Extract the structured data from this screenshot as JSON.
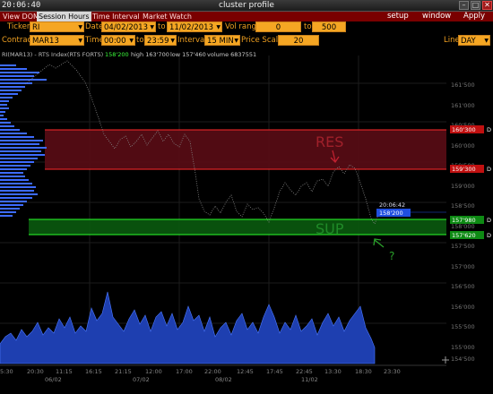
{
  "window": {
    "clock": "20:06:40",
    "title": "cluster profile",
    "minimize": "–",
    "maximize": "□",
    "close": "✕"
  },
  "menu": {
    "tabs": [
      "View DOM",
      "Session Hours",
      "Time Interval",
      "Market Watch"
    ],
    "active_tab": "Session Hours",
    "right": [
      "setup",
      "window",
      "Apply"
    ]
  },
  "params": {
    "ticker_label": "Ticker",
    "ticker": "RI",
    "date_label": "Date",
    "date_from": "04/02/2013",
    "to_label": "to",
    "date_to": "11/02/2013",
    "vol_range_label": "Vol range",
    "vol_from": "0",
    "vol_to_label": "to",
    "vol_to": "500",
    "contract_label": "Contract",
    "contract": "MAR13",
    "time_label": "Time",
    "time_from": "00:00",
    "time_to_label": "to",
    "time_to": "23:59",
    "interval_label": "Interval",
    "interval": "15 MIN",
    "price_scale_label": "Price Scale",
    "price_scale": "20",
    "line_label": "Line",
    "line": "DAY"
  },
  "legend": {
    "symbol": "RI(MAR13) - RTS Index(RTS FORTS)",
    "last": "158'200",
    "high": "high 163'700",
    "low": "low 157'460",
    "volume": "volume 6837551"
  },
  "price_axis": [
    "161'500",
    "161'000",
    "160'500",
    "160'000",
    "159'500",
    "159'000",
    "158'500",
    "158'000",
    "157'500",
    "157'000",
    "156'500",
    "156'000",
    "155'500",
    "155'000",
    "154'500"
  ],
  "levels": {
    "res_top": "160'300",
    "res_bottom": "159'300",
    "sup_top": "157'980",
    "sup_bottom": "157'620",
    "cursor_time": "20:06:42",
    "cursor_price": "158'200",
    "res_text": "RES",
    "sup_text": "SUP",
    "question": "?",
    "marker": "D"
  },
  "colors": {
    "res_zone": "#6a0e18",
    "sup_zone": "#0e6a12",
    "res_line": "#ff2a2a",
    "sup_line": "#2aff2a",
    "volume": "#2a56d8",
    "profile": "#3d6bff"
  },
  "time_axis": [
    "5:30",
    "20:30",
    "11:15",
    "16:15",
    "21:15",
    "12:00",
    "17:00",
    "22:00",
    "12:45",
    "17:45",
    "22:45",
    "13:30",
    "18:30",
    "23:30"
  ],
  "date_axis": [
    "06/02",
    "07/02",
    "08/02",
    "11/02"
  ]
}
